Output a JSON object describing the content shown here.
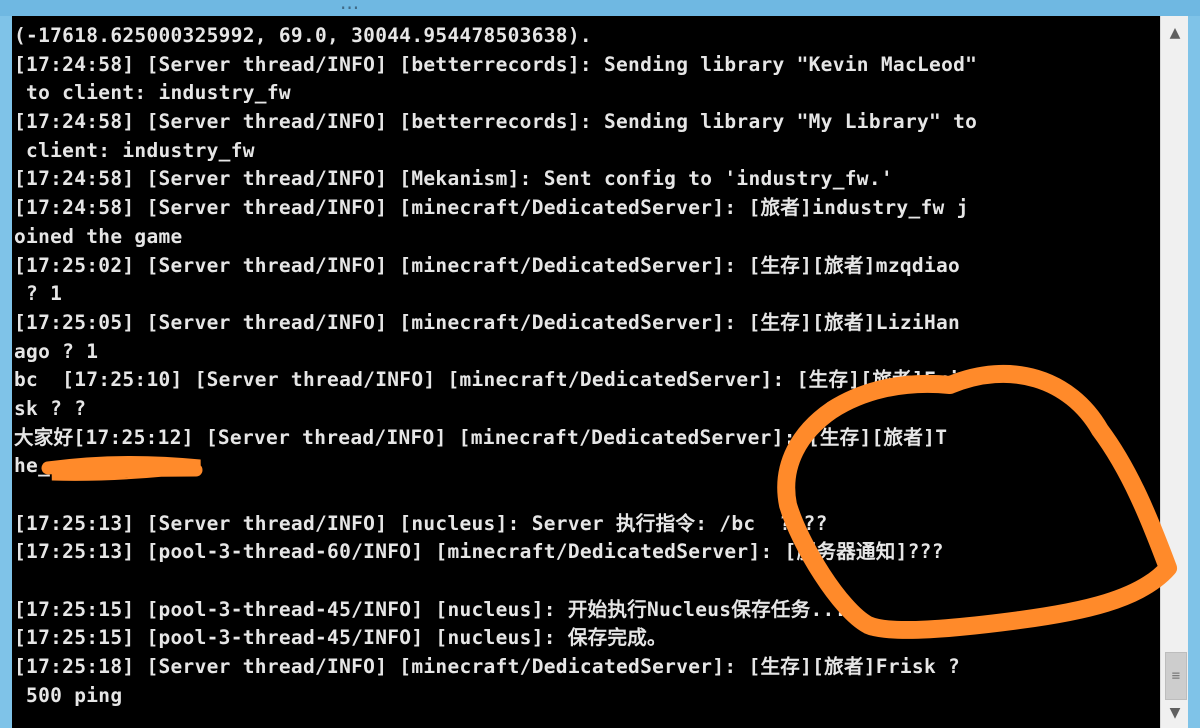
{
  "window": {
    "title": "..."
  },
  "console": {
    "lines": [
      "(-17618.625000325992, 69.0, 30044.954478503638).",
      "[17:24:58] [Server thread/INFO] [betterrecords]: Sending library \"Kevin MacLeod\"",
      " to client: industry_fw",
      "[17:24:58] [Server thread/INFO] [betterrecords]: Sending library \"My Library\" to",
      " client: industry_fw",
      "[17:24:58] [Server thread/INFO] [Mekanism]: Sent config to 'industry_fw.'",
      "[17:24:58] [Server thread/INFO] [minecraft/DedicatedServer]: [旅者]industry_fw j",
      "oined the game",
      "[17:25:02] [Server thread/INFO] [minecraft/DedicatedServer]: [生存][旅者]mzqdiao",
      " ? 1",
      "[17:25:05] [Server thread/INFO] [minecraft/DedicatedServer]: [生存][旅者]LiziHan",
      "ago ? 1",
      "bc  [17:25:10] [Server thread/INFO] [minecraft/DedicatedServer]: [生存][旅者]Fri",
      "sk ? ?",
      "大家好[17:25:12] [Server thread/INFO] [minecraft/DedicatedServer]: [生存][旅者]T",
      "he_     ? 111",
      "",
      "[17:25:13] [Server thread/INFO] [nucleus]: Server 执行指令: /bc  ????",
      "[17:25:13] [pool-3-thread-60/INFO] [minecraft/DedicatedServer]: [服务器通知]???",
      "",
      "[17:25:15] [pool-3-thread-45/INFO] [nucleus]: 开始执行Nucleus保存任务...",
      "[17:25:15] [pool-3-thread-45/INFO] [nucleus]: 保存完成。",
      "[17:25:18] [Server thread/INFO] [minecraft/DedicatedServer]: [生存][旅者]Frisk ?",
      " 500 ping"
    ]
  },
  "scrollbar": {
    "up_icon": "▲",
    "down_icon": "▼",
    "thumb_icon": "≡"
  },
  "annotations": {
    "color": "#ff8a2a"
  }
}
